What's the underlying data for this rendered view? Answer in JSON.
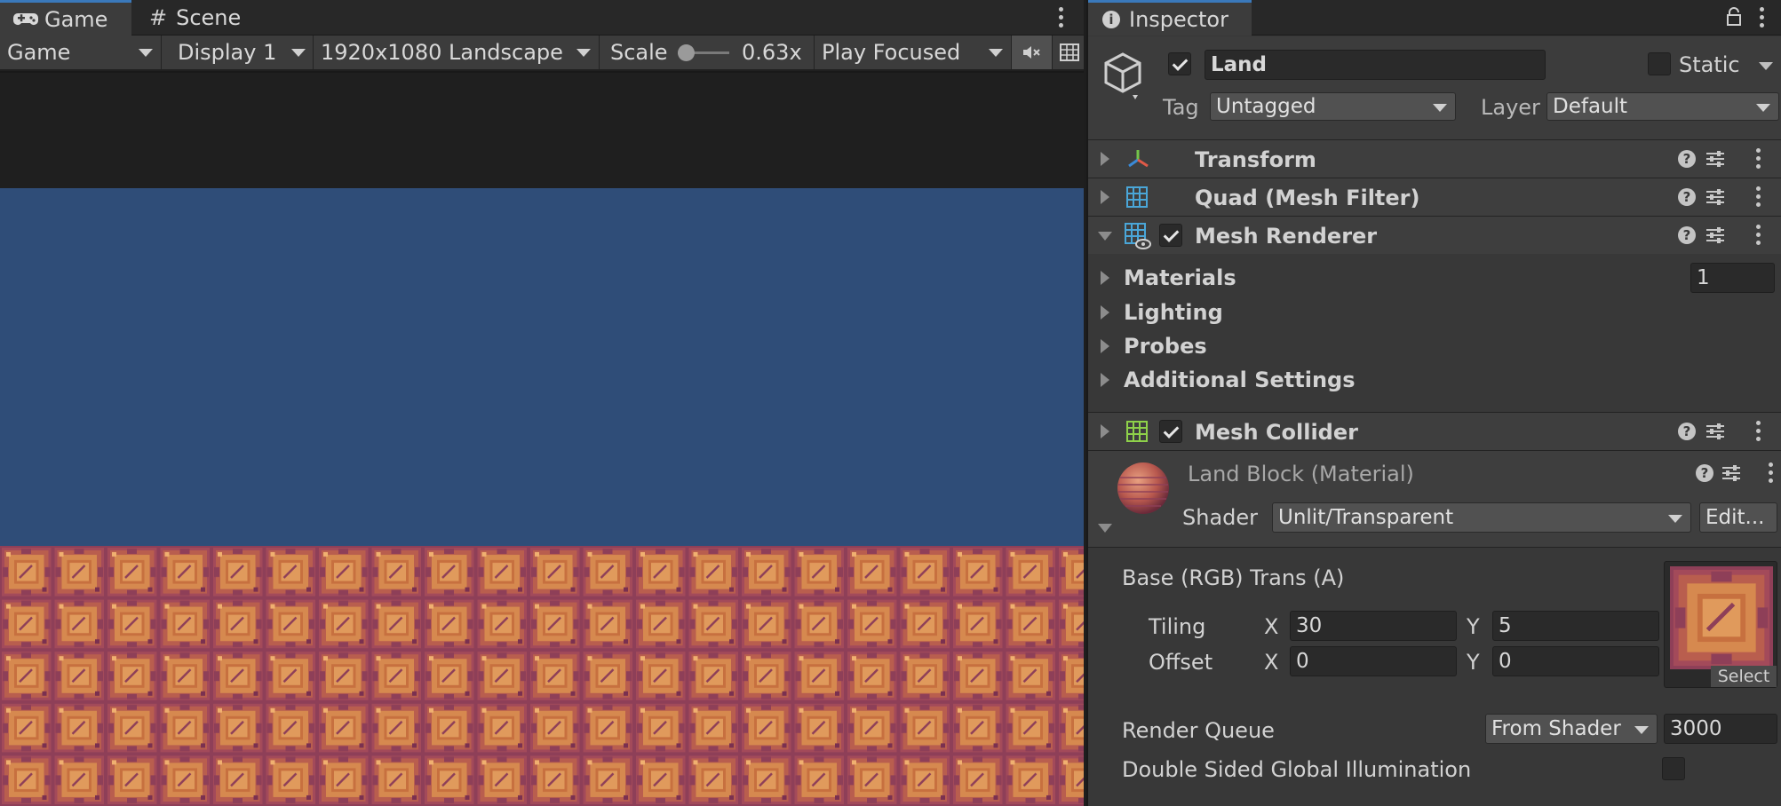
{
  "tabs": {
    "game": "Game",
    "scene": "Scene",
    "inspector": "Inspector"
  },
  "game_toolbar": {
    "mode": "Game",
    "display": "Display 1",
    "resolution": "1920x1080 Landscape",
    "scale_label": "Scale",
    "scale_value": "0.63x",
    "play_mode": "Play Focused"
  },
  "object": {
    "name": "Land",
    "active": true,
    "static_label": "Static",
    "static": false,
    "tag_label": "Tag",
    "tag": "Untagged",
    "layer_label": "Layer",
    "layer": "Default"
  },
  "components": {
    "transform": "Transform",
    "mesh_filter": "Quad (Mesh Filter)",
    "mesh_renderer": "Mesh Renderer",
    "mesh_collider": "Mesh Collider"
  },
  "mesh_renderer": {
    "enabled": true,
    "materials_label": "Materials",
    "materials_count": "1",
    "lighting": "Lighting",
    "probes": "Probes",
    "additional": "Additional Settings"
  },
  "mesh_collider": {
    "enabled": true
  },
  "material": {
    "title": "Land Block (Material)",
    "shader_label": "Shader",
    "shader": "Unlit/Transparent",
    "edit_button": "Edit...",
    "base_label": "Base (RGB) Trans (A)",
    "tiling_label": "Tiling",
    "offset_label": "Offset",
    "x_label": "X",
    "y_label": "Y",
    "tiling_x": "30",
    "tiling_y": "5",
    "offset_x": "0",
    "offset_y": "0",
    "select_button": "Select",
    "render_queue_label": "Render Queue",
    "render_queue_source": "From Shader",
    "render_queue_value": "3000",
    "dsgi_label": "Double Sided Global Illumination",
    "dsgi": false
  },
  "colors": {
    "sky": "#2f4d78",
    "tile_base": "#8e3f58",
    "tile_face": "#c97a4a",
    "accent_tab": "#3a79bb"
  }
}
